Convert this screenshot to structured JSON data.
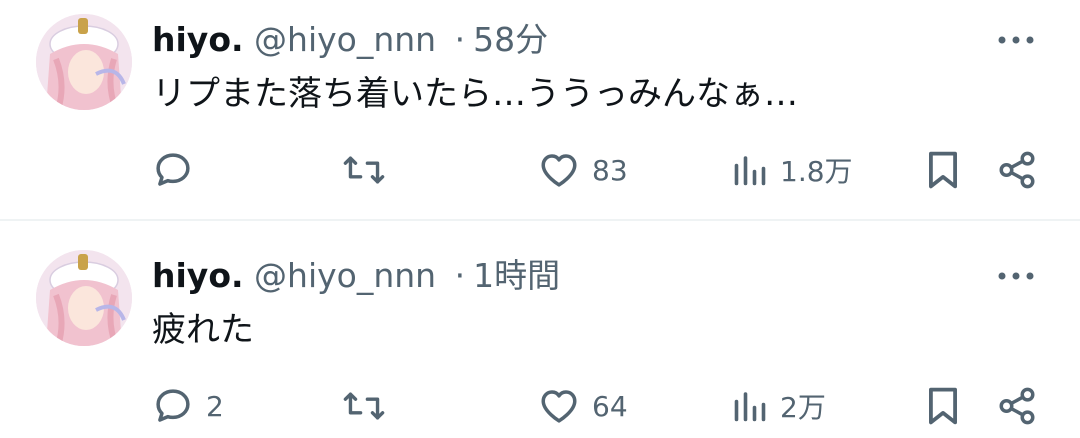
{
  "colors": {
    "text_primary": "#0f1419",
    "text_secondary": "#536471",
    "divider": "#eff3f4",
    "background": "#ffffff"
  },
  "tweets": [
    {
      "display_name": "hiyo.",
      "handle": "@hiyo_nnn",
      "separator": "·",
      "time": "58分",
      "text": "リプまた落ち着いたら…ううっみんなぁ…",
      "reply_count": "",
      "retweet_count": "",
      "like_count": "83",
      "view_count": "1.8万",
      "icons": [
        "reply-icon",
        "retweet-icon",
        "like-icon",
        "views-icon",
        "bookmark-icon",
        "share-icon",
        "more-icon"
      ]
    },
    {
      "display_name": "hiyo.",
      "handle": "@hiyo_nnn",
      "separator": "·",
      "time": "1時間",
      "text": "疲れた",
      "reply_count": "2",
      "retweet_count": "",
      "like_count": "64",
      "view_count": "2万",
      "icons": [
        "reply-icon",
        "retweet-icon",
        "like-icon",
        "views-icon",
        "bookmark-icon",
        "share-icon",
        "more-icon"
      ]
    }
  ]
}
